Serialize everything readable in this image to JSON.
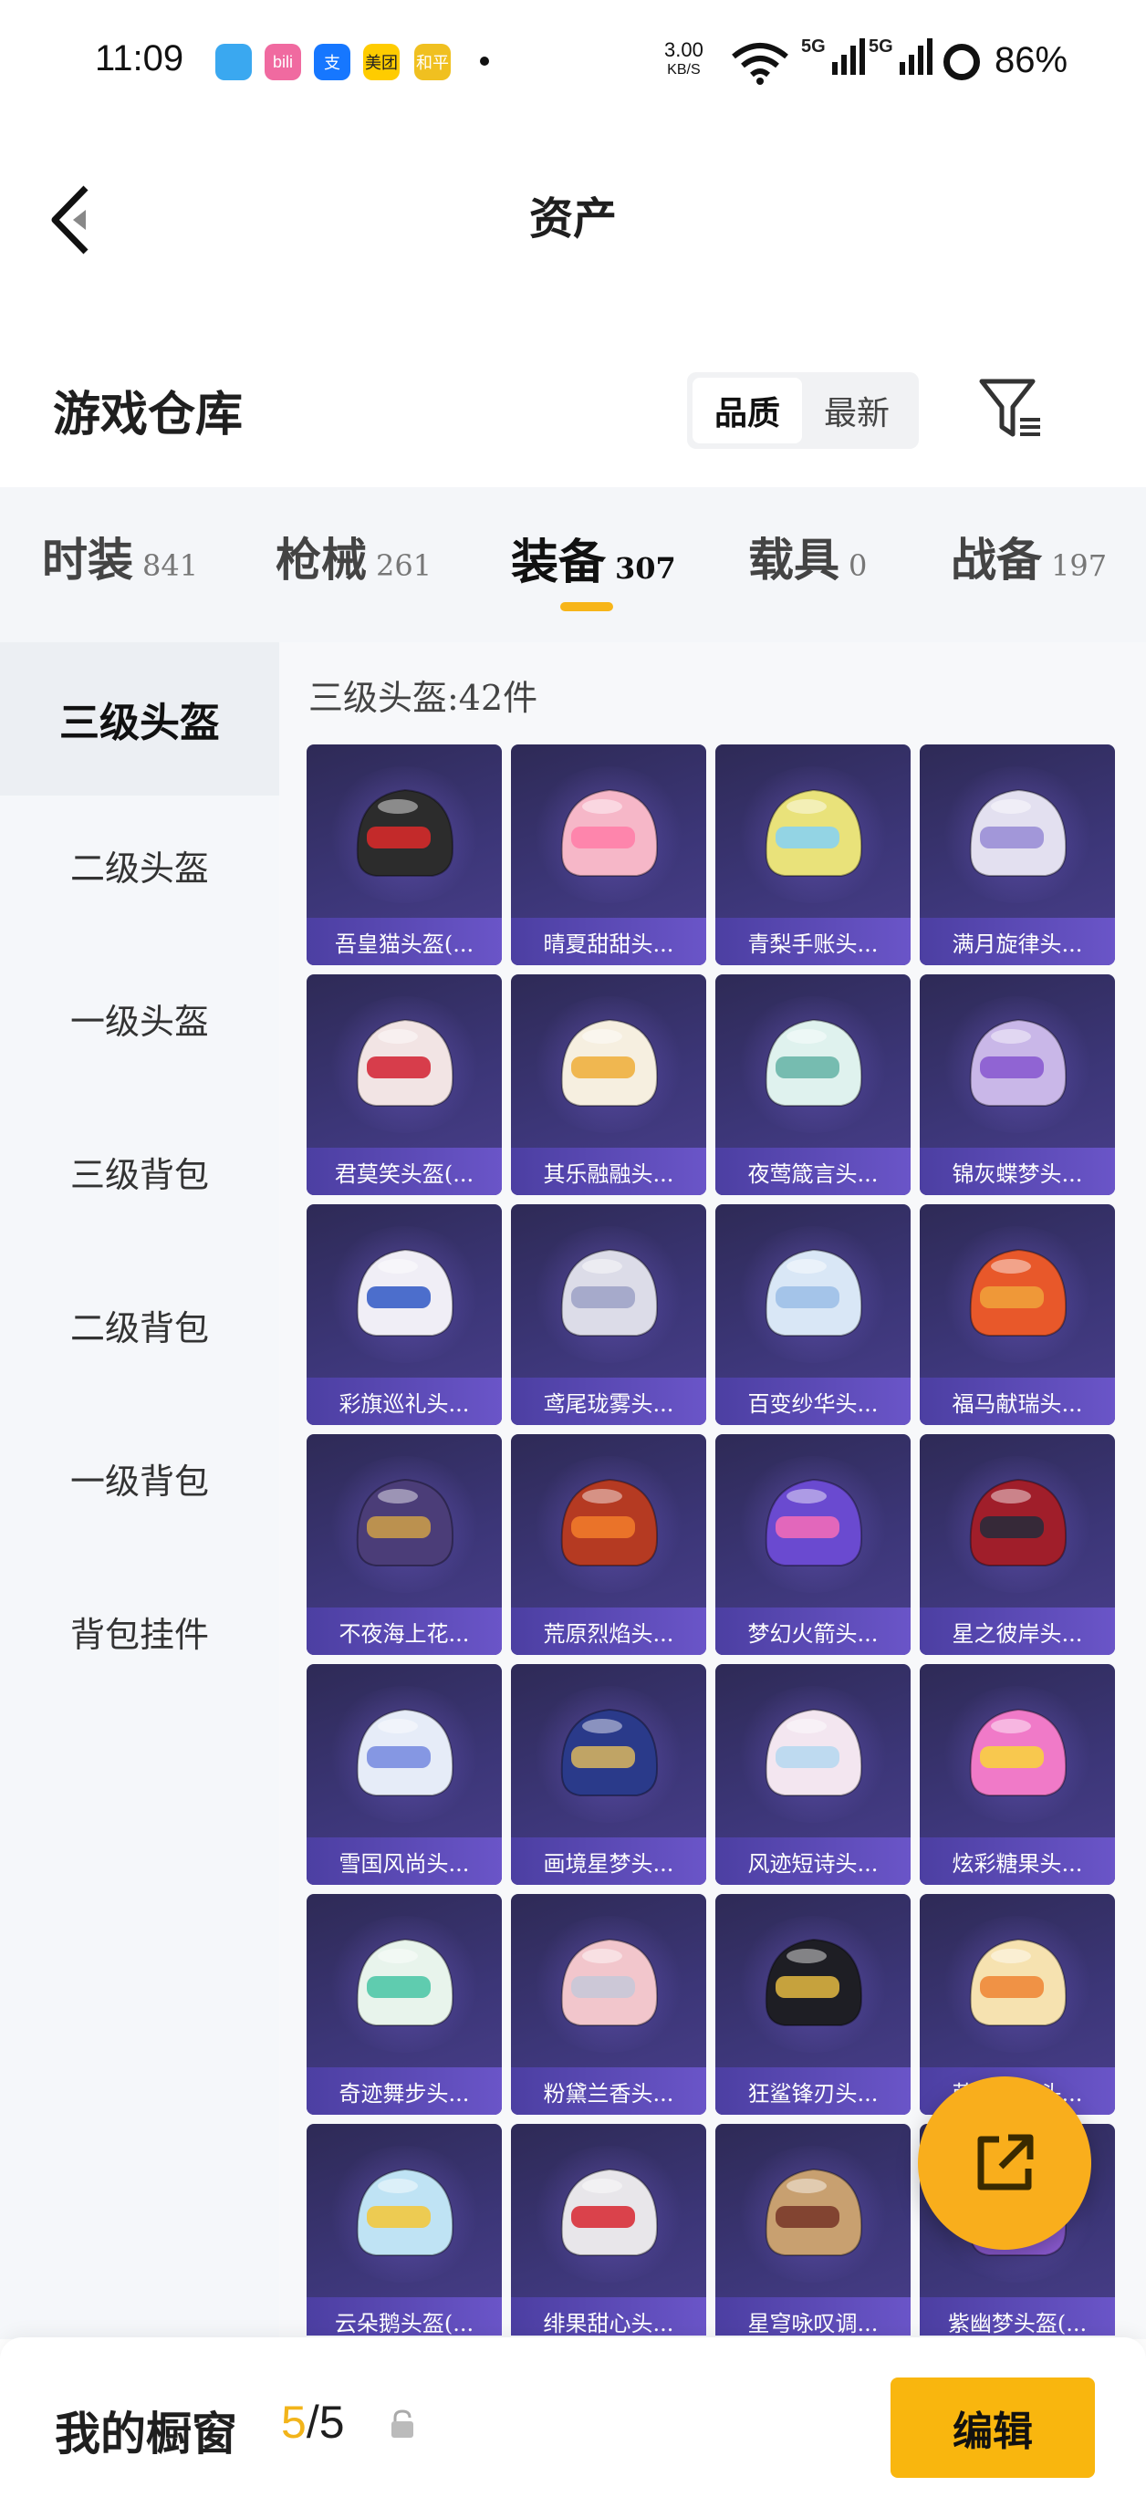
{
  "status_bar": {
    "time": "11:09",
    "net_speed": "3.00",
    "net_unit": "KB/S",
    "signal1": "5G",
    "signal2": "5G",
    "battery": "86%",
    "app_icons": [
      {
        "name": "qq-browser-icon",
        "text": "",
        "color": "#3aa8f0"
      },
      {
        "name": "bilibili-icon",
        "text": "bili",
        "color": "#f06aa0"
      },
      {
        "name": "alipay-icon",
        "text": "支",
        "color": "#1677ff"
      },
      {
        "name": "meituan-icon",
        "text": "美团",
        "color": "#ffcc00"
      },
      {
        "name": "heping-jingying-icon",
        "text": "和平",
        "color": "#f0c020"
      }
    ]
  },
  "header": {
    "title": "资产"
  },
  "section": {
    "title": "游戏仓库"
  },
  "sort": {
    "quality": "品质",
    "newest": "最新"
  },
  "tabs": [
    {
      "label": "时装",
      "count": "841",
      "active": false
    },
    {
      "label": "枪械",
      "count": "261",
      "active": false
    },
    {
      "label": "装备",
      "count": "307",
      "active": true
    },
    {
      "label": "载具",
      "count": "0",
      "active": false
    },
    {
      "label": "战备",
      "count": "197",
      "active": false
    }
  ],
  "sidebar": [
    {
      "label": "三级头盔",
      "active": true
    },
    {
      "label": "二级头盔",
      "active": false
    },
    {
      "label": "一级头盔",
      "active": false
    },
    {
      "label": "三级背包",
      "active": false
    },
    {
      "label": "二级背包",
      "active": false
    },
    {
      "label": "一级背包",
      "active": false
    },
    {
      "label": "背包挂件",
      "active": false
    }
  ],
  "category_count": "三级头盔:42件",
  "items": [
    {
      "name": "吾皇猫头盔(...",
      "color": "#2c2c2c",
      "accent": "#d42a2a"
    },
    {
      "name": "晴夏甜甜头...",
      "color": "#f6b7c8",
      "accent": "#ff7fa8"
    },
    {
      "name": "青梨手账头...",
      "color": "#e9e27a",
      "accent": "#8ad3f0"
    },
    {
      "name": "满月旋律头...",
      "color": "#e3e0f0",
      "accent": "#9a8fd6"
    },
    {
      "name": "君莫笑头盔(...",
      "color": "#f2e4e4",
      "accent": "#d42a3a"
    },
    {
      "name": "其乐融融头...",
      "color": "#f6efe0",
      "accent": "#f0b040"
    },
    {
      "name": "夜莺箴言头...",
      "color": "#dff2ee",
      "accent": "#6ab6a8"
    },
    {
      "name": "锦灰蝶梦头...",
      "color": "#c9b7e8",
      "accent": "#8a5bd0"
    },
    {
      "name": "彩旗巡礼头...",
      "color": "#f0eef6",
      "accent": "#3a5fc8"
    },
    {
      "name": "鸢尾珑雾头...",
      "color": "#dcdce8",
      "accent": "#a0a4c8"
    },
    {
      "name": "百变纱华头...",
      "color": "#d9e7f6",
      "accent": "#9dc0e8"
    },
    {
      "name": "福马献瑞头...",
      "color": "#e8582a",
      "accent": "#f0a03a"
    },
    {
      "name": "不夜海上花...",
      "color": "#4b3d78",
      "accent": "#c89a4a"
    },
    {
      "name": "荒原烈焰头...",
      "color": "#b53a22",
      "accent": "#f07a2a"
    },
    {
      "name": "梦幻火箭头...",
      "color": "#6a4ad0",
      "accent": "#f06ab8"
    },
    {
      "name": "星之彼岸头...",
      "color": "#a01e2a",
      "accent": "#2a2a3a"
    },
    {
      "name": "雪国风尚头...",
      "color": "#e6ecf8",
      "accent": "#7a8ee0"
    },
    {
      "name": "画境星梦头...",
      "color": "#2a3a8a",
      "accent": "#d0b060"
    },
    {
      "name": "风迹短诗头...",
      "color": "#f3e6f0",
      "accent": "#b8d8f0"
    },
    {
      "name": "炫彩糖果头...",
      "color": "#f07ac8",
      "accent": "#f8d040"
    },
    {
      "name": "奇迹舞步头...",
      "color": "#e8f4ec",
      "accent": "#50c8a8"
    },
    {
      "name": "粉黛兰香头...",
      "color": "#f2c6cc",
      "accent": "#c8c8d8"
    },
    {
      "name": "狂鲨锋刃头...",
      "color": "#1e1e24",
      "accent": "#d8b040"
    },
    {
      "name": "萌萌布丁头...",
      "color": "#f6e2b0",
      "accent": "#f08a3a"
    },
    {
      "name": "云朵鹅头盔(...",
      "color": "#bfe3f4",
      "accent": "#f2c840"
    },
    {
      "name": "绯果甜心头...",
      "color": "#e8e6ea",
      "accent": "#d8303a"
    },
    {
      "name": "星穹咏叹调...",
      "color": "#c8a070",
      "accent": "#7a3a2a"
    },
    {
      "name": "紫幽梦头盔(...",
      "color": "#8a5ad0",
      "accent": "#e0b0f0"
    }
  ],
  "showcase": {
    "label": "我的橱窗",
    "current": "5",
    "total": "/5"
  },
  "edit_label": "编辑"
}
